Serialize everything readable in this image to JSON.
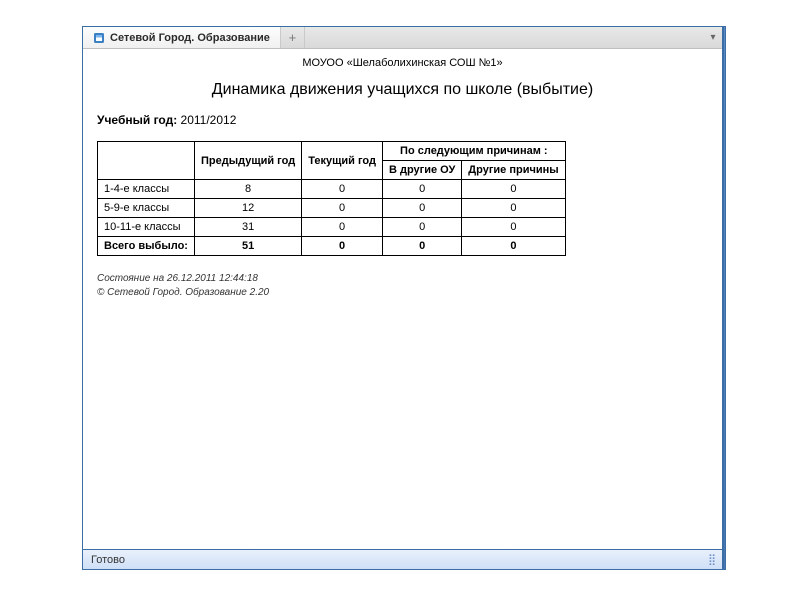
{
  "tab": {
    "favicon_fill": "#3b7fc4",
    "title": "Сетевой Город. Образование",
    "newtab_glyph": "+",
    "menu_glyph": "▾"
  },
  "report": {
    "org": "МОУОО «Шелаболихинская СОШ №1»",
    "title": "Динамика движения учащихся по школе (выбытие)",
    "year_label": "Учебный год:",
    "year_value": "2011/2012"
  },
  "table": {
    "headers": {
      "blank": "",
      "prev": "Предыдущий год",
      "curr": "Текущий год",
      "reasons": "По следующим причинам :",
      "reason_other_ou": "В другие ОУ",
      "reason_other": "Другие причины"
    },
    "rows": [
      {
        "label": "1-4-е классы",
        "prev": "8",
        "curr": "0",
        "other_ou": "0",
        "other": "0"
      },
      {
        "label": "5-9-е классы",
        "prev": "12",
        "curr": "0",
        "other_ou": "0",
        "other": "0"
      },
      {
        "label": "10-11-е классы",
        "prev": "31",
        "curr": "0",
        "other_ou": "0",
        "other": "0"
      }
    ],
    "total": {
      "label": "Всего выбыло:",
      "prev": "51",
      "curr": "0",
      "other_ou": "0",
      "other": "0"
    }
  },
  "footer": {
    "asof": "Состояние на 26.12.2011 12:44:18",
    "copyright": "© Сетевой Город. Образование 2.20"
  },
  "status": {
    "text": "Готово"
  }
}
